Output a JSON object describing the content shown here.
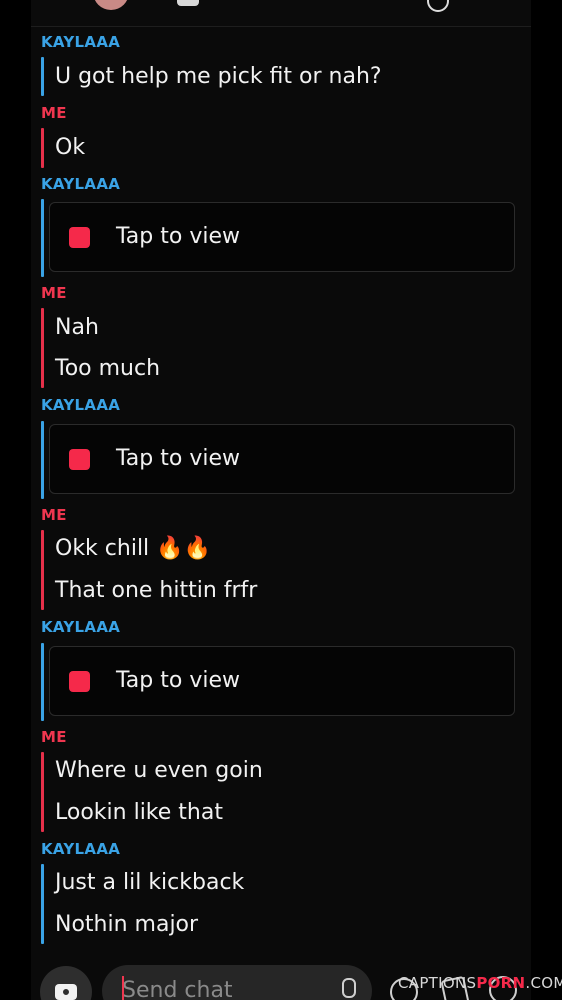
{
  "messages": [
    {
      "sender": "KAYLAAA",
      "lines": [
        "U got help me pick fit or nah?"
      ]
    },
    {
      "sender": "ME",
      "lines": [
        "Ok"
      ]
    },
    {
      "sender": "KAYLAAA",
      "snap": "Tap to view"
    },
    {
      "sender": "ME",
      "lines": [
        "Nah",
        "Too much"
      ]
    },
    {
      "sender": "KAYLAAA",
      "snap": "Tap to view"
    },
    {
      "sender": "ME",
      "lines": [
        "Okk chill 🔥🔥",
        "That one hittin frfr"
      ]
    },
    {
      "sender": "KAYLAAA",
      "snap": "Tap to view"
    },
    {
      "sender": "ME",
      "lines": [
        "Where u even goin",
        "Lookin like that"
      ]
    },
    {
      "sender": "KAYLAAA",
      "lines": [
        "Just a lil kickback",
        "Nothin major"
      ]
    }
  ],
  "composer": {
    "placeholder": "Send chat"
  },
  "watermark": {
    "pre": "CAPTIONS",
    "brand": "PORN",
    "post": ".COM"
  },
  "colors": {
    "friend": "#3aa3e6",
    "me": "#f0364f",
    "snap_unopened": "#f5294a"
  }
}
